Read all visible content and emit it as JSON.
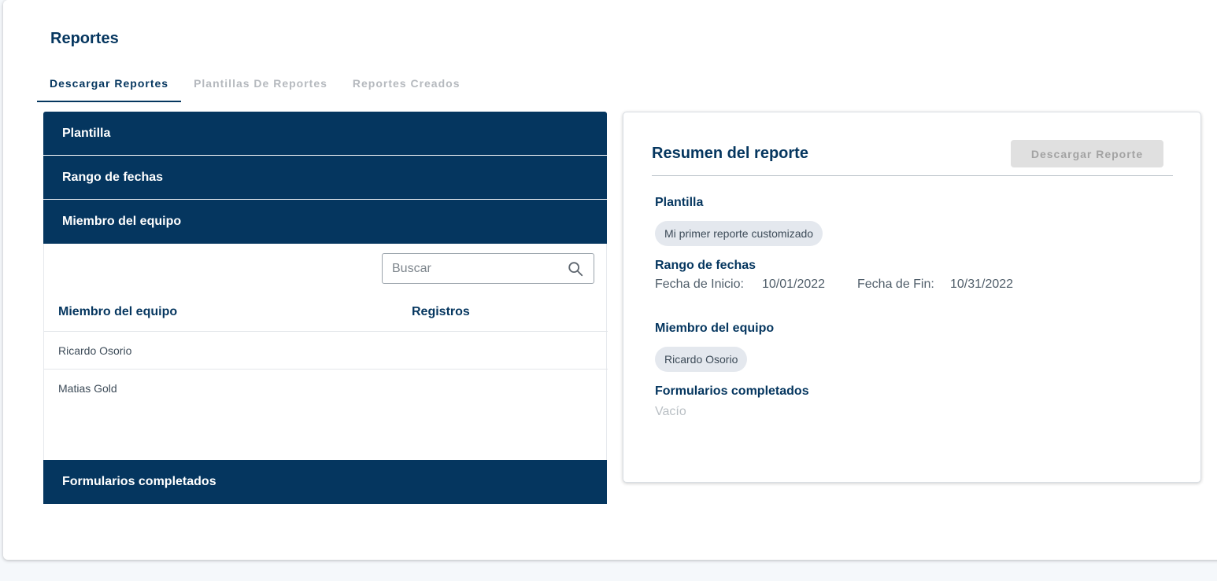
{
  "page": {
    "title": "Reportes"
  },
  "tabs": [
    {
      "label": "Descargar Reportes",
      "active": true
    },
    {
      "label": "Plantillas De Reportes",
      "active": false
    },
    {
      "label": "Reportes Creados",
      "active": false
    }
  ],
  "left_panel": {
    "sections": {
      "plantilla": "Plantilla",
      "rango": "Rango de fechas",
      "miembro": "Miembro del equipo",
      "formularios": "Formularios completados"
    },
    "search": {
      "placeholder": "Buscar",
      "icon": "search-icon"
    },
    "table": {
      "headers": [
        "Miembro del equipo",
        "Registros"
      ],
      "rows": [
        "Ricardo Osorio",
        "Matias Gold"
      ]
    }
  },
  "summary": {
    "title": "Resumen del reporte",
    "download_button": "Descargar Reporte",
    "plantilla_label": "Plantilla",
    "plantilla_value": "Mi primer reporte customizado",
    "rango_label": "Rango de fechas",
    "start_label": "Fecha de Inicio:",
    "start_value": "10/01/2022",
    "end_label": "Fecha de Fin:",
    "end_value": "10/31/2022",
    "miembro_label": "Miembro del equipo",
    "miembro_value": "Ricardo Osorio",
    "formularios_label": "Formularios completados",
    "formularios_value": "Vacío"
  },
  "colors": {
    "primary": "#05365f",
    "disabled_button": "#e0e0e0",
    "chip": "#e4e8ee"
  }
}
